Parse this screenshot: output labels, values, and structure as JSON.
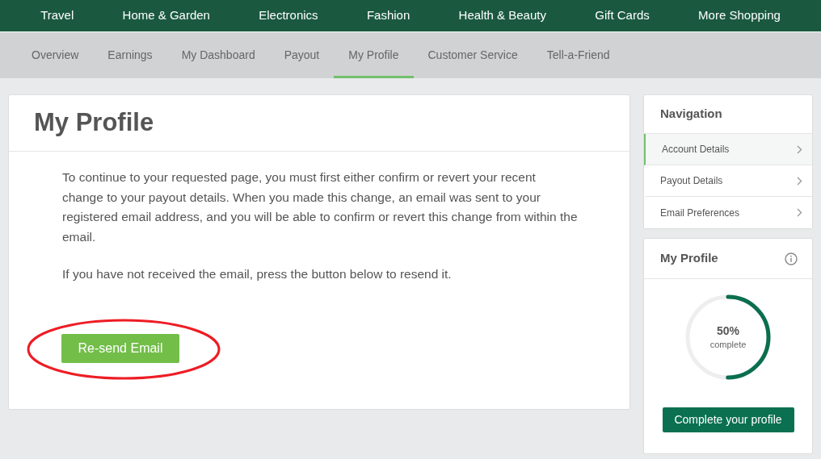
{
  "top_nav": [
    {
      "label": "Travel"
    },
    {
      "label": "Home & Garden"
    },
    {
      "label": "Electronics"
    },
    {
      "label": "Fashion"
    },
    {
      "label": "Health & Beauty"
    },
    {
      "label": "Gift Cards"
    },
    {
      "label": "More Shopping"
    }
  ],
  "sub_nav": [
    {
      "label": "Overview",
      "selected": false
    },
    {
      "label": "Earnings",
      "selected": false
    },
    {
      "label": "My Dashboard",
      "selected": false
    },
    {
      "label": "Payout",
      "selected": false
    },
    {
      "label": "My Profile",
      "selected": true
    },
    {
      "label": "Customer Service",
      "selected": false
    },
    {
      "label": "Tell-a-Friend",
      "selected": false
    }
  ],
  "main": {
    "title": "My Profile",
    "paragraphs": [
      "To continue to your requested page, you must first either confirm or revert your recent change to your payout details. When you made this change, an email was sent to your registered email address, and you will be able to confirm or revert this change from within the email.",
      "If you have not received the email, press the button below to resend it."
    ],
    "button": "Re-send Email",
    "annotation": {
      "kind": "ellipse"
    }
  },
  "navigation": {
    "title": "Navigation",
    "items": [
      {
        "label": "Account Details",
        "selected": true
      },
      {
        "label": "Payout Details",
        "selected": false
      },
      {
        "label": "Email Preferences",
        "selected": false
      }
    ]
  },
  "profile": {
    "title": "My Profile",
    "level": 0.5,
    "percent": "50%",
    "caption": "complete",
    "button": "Complete your profile"
  }
}
